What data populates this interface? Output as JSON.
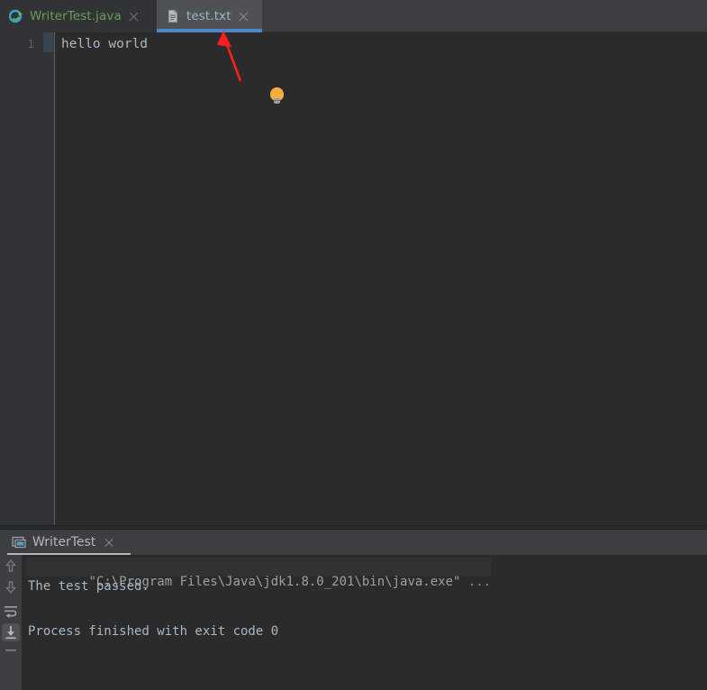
{
  "window": {
    "background": "#2b2b2b",
    "accent_blue": "#4a88c7",
    "annotation_color": "#ff1e1e"
  },
  "editor_tabs": {
    "tabs": [
      {
        "label": "WriterTest.java",
        "icon": "java-class-icon",
        "active": false,
        "close_icon": "close-icon",
        "text_color": "#6a9c5a"
      },
      {
        "label": "test.txt",
        "icon": "text-file-icon",
        "active": true,
        "close_icon": "close-icon",
        "text_color": "#9fb5c9"
      }
    ]
  },
  "editor": {
    "line_number": "1",
    "content": "hello world",
    "intention_bulb_icon": "lightbulb-icon",
    "gutter_change_marker": "changed-lines-marker"
  },
  "annotation": {
    "arrow_icon": "red-arrow-icon",
    "points_to": "active-tab-underline"
  },
  "console": {
    "tab_label": "WriterTest",
    "tab_icon": "run-console-icon",
    "tab_close_icon": "close-icon",
    "toolbar": [
      {
        "name": "up-arrow-icon",
        "label": "Up the stack trace",
        "active": false
      },
      {
        "name": "down-arrow-icon",
        "label": "Down the stack trace",
        "active": false
      },
      {
        "name": "soft-wrap-icon",
        "label": "Use Soft Wraps",
        "active": false
      },
      {
        "name": "scroll-to-end-icon",
        "label": "Scroll to End",
        "active": true
      },
      {
        "name": "print-icon",
        "label": "Print",
        "active": false
      }
    ],
    "lines": [
      {
        "text": "\"C:\\Program Files\\Java\\jdk1.8.0_201\\bin\\java.exe\" ",
        "suffix": "...",
        "highlighted": true
      },
      {
        "text": "The test passed.",
        "suffix": "",
        "highlighted": false
      },
      {
        "text": "",
        "suffix": "",
        "highlighted": false
      },
      {
        "text": "Process finished with exit code 0",
        "suffix": "",
        "highlighted": false
      }
    ]
  }
}
